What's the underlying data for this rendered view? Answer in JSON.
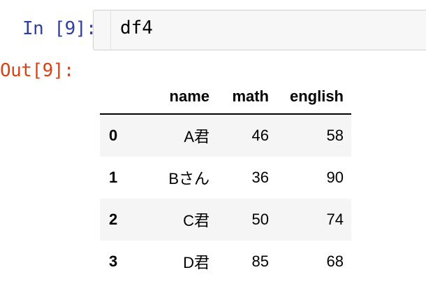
{
  "cell": {
    "in_prompt": "In [9]:",
    "code": "df4",
    "out_prompt": "Out[9]:"
  },
  "table": {
    "columns": [
      "",
      "name",
      "math",
      "english"
    ],
    "rows": [
      {
        "index": "0",
        "name": "A君",
        "math": "46",
        "english": "58"
      },
      {
        "index": "1",
        "name": "Bさん",
        "math": "36",
        "english": "90"
      },
      {
        "index": "2",
        "name": "C君",
        "math": "50",
        "english": "74"
      },
      {
        "index": "3",
        "name": "D君",
        "math": "85",
        "english": "68"
      }
    ]
  },
  "colors": {
    "in_prompt": "#303f9f",
    "out_prompt": "#d84315",
    "input_bg": "#f7f7f7",
    "stripe_bg": "#f5f5f5"
  }
}
